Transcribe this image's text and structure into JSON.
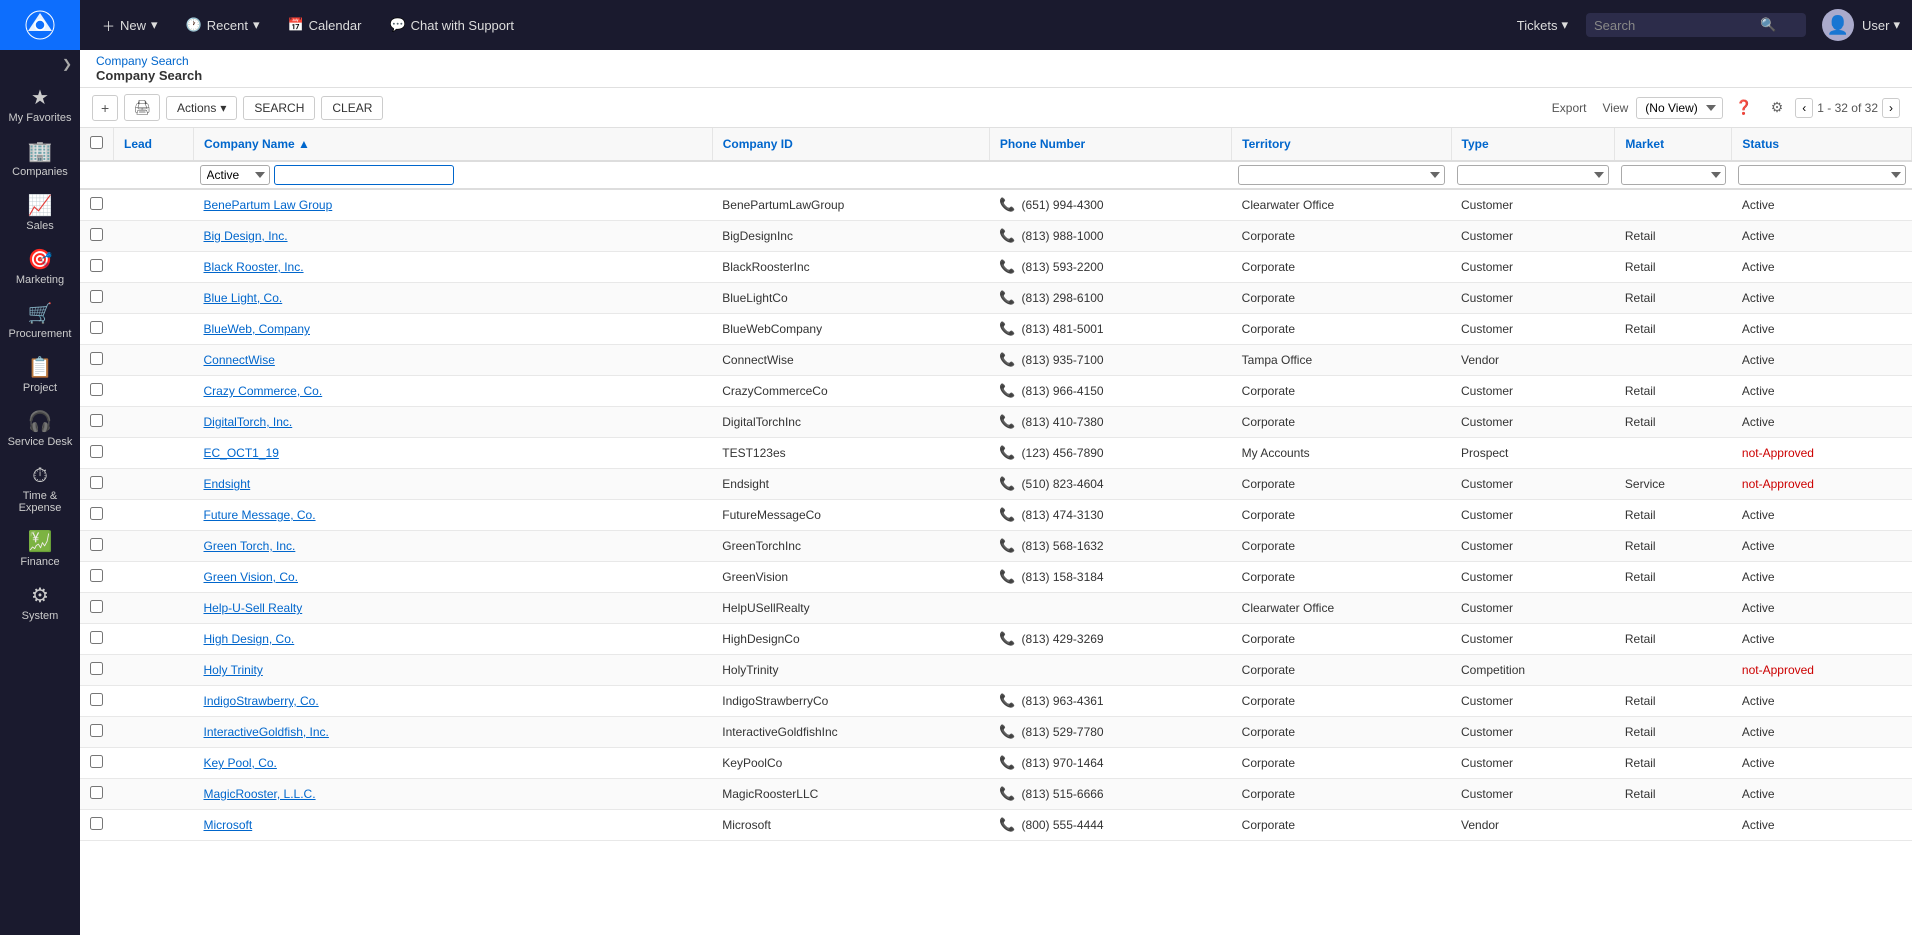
{
  "app": {
    "logo_alt": "ConnectWise",
    "topnav": {
      "new_label": "New",
      "recent_label": "Recent",
      "calendar_label": "Calendar",
      "chat_label": "Chat with Support",
      "tickets_label": "Tickets",
      "search_placeholder": "Search",
      "user_name": "User"
    }
  },
  "sidebar": {
    "items": [
      {
        "id": "favorites",
        "label": "My Favorites",
        "icon": "★"
      },
      {
        "id": "companies",
        "label": "Companies",
        "icon": "🏢"
      },
      {
        "id": "sales",
        "label": "Sales",
        "icon": "📈"
      },
      {
        "id": "marketing",
        "label": "Marketing",
        "icon": "🎯"
      },
      {
        "id": "procurement",
        "label": "Procurement",
        "icon": "🛒"
      },
      {
        "id": "project",
        "label": "Project",
        "icon": "📋"
      },
      {
        "id": "service-desk",
        "label": "Service Desk",
        "icon": "🎧"
      },
      {
        "id": "time-expense",
        "label": "Time & Expense",
        "icon": "⏱"
      },
      {
        "id": "finance",
        "label": "Finance",
        "icon": "💹"
      },
      {
        "id": "system",
        "label": "System",
        "icon": "⚙"
      }
    ]
  },
  "breadcrumb": {
    "parent": "Company Search",
    "current": "Company Search"
  },
  "toolbar": {
    "add_icon": "+",
    "print_icon": "🖨",
    "actions_label": "Actions",
    "search_label": "SEARCH",
    "clear_label": "CLEAR",
    "export_label": "Export",
    "view_label": "View",
    "view_placeholder": "(No View)",
    "pagination": "1 - 32 of 32"
  },
  "table": {
    "columns": [
      {
        "id": "checkbox",
        "label": ""
      },
      {
        "id": "lead",
        "label": "Lead"
      },
      {
        "id": "company_name",
        "label": "Company Name",
        "sorted": "asc"
      },
      {
        "id": "company_id",
        "label": "Company ID"
      },
      {
        "id": "phone_number",
        "label": "Phone Number"
      },
      {
        "id": "territory",
        "label": "Territory"
      },
      {
        "id": "type",
        "label": "Type"
      },
      {
        "id": "market",
        "label": "Market"
      },
      {
        "id": "status",
        "label": "Status"
      }
    ],
    "filter": {
      "active_value": "Active"
    },
    "rows": [
      {
        "lead": "",
        "company_name": "BenePartum Law Group",
        "company_id": "BenePartumLawGroup",
        "phone": "(651) 994-4300",
        "territory": "Clearwater Office",
        "type": "Customer",
        "market": "",
        "status": "Active",
        "has_phone": true
      },
      {
        "lead": "",
        "company_name": "Big Design, Inc.",
        "company_id": "BigDesignInc",
        "phone": "(813) 988-1000",
        "territory": "Corporate",
        "type": "Customer",
        "market": "Retail",
        "status": "Active",
        "has_phone": true
      },
      {
        "lead": "",
        "company_name": "Black Rooster, Inc.",
        "company_id": "BlackRoosterInc",
        "phone": "(813) 593-2200",
        "territory": "Corporate",
        "type": "Customer",
        "market": "Retail",
        "status": "Active",
        "has_phone": true
      },
      {
        "lead": "",
        "company_name": "Blue Light, Co.",
        "company_id": "BlueLightCo",
        "phone": "(813) 298-6100",
        "territory": "Corporate",
        "type": "Customer",
        "market": "Retail",
        "status": "Active",
        "has_phone": true
      },
      {
        "lead": "",
        "company_name": "BlueWeb, Company",
        "company_id": "BlueWebCompany",
        "phone": "(813) 481-5001",
        "territory": "Corporate",
        "type": "Customer",
        "market": "Retail",
        "status": "Active",
        "has_phone": true
      },
      {
        "lead": "",
        "company_name": "ConnectWise",
        "company_id": "ConnectWise",
        "phone": "(813) 935-7100",
        "territory": "Tampa Office",
        "type": "Vendor",
        "market": "",
        "status": "Active",
        "has_phone": true
      },
      {
        "lead": "",
        "company_name": "Crazy Commerce, Co.",
        "company_id": "CrazyCommerceCo",
        "phone": "(813) 966-4150",
        "territory": "Corporate",
        "type": "Customer",
        "market": "Retail",
        "status": "Active",
        "has_phone": true
      },
      {
        "lead": "",
        "company_name": "DigitalTorch, Inc.",
        "company_id": "DigitalTorchInc",
        "phone": "(813) 410-7380",
        "territory": "Corporate",
        "type": "Customer",
        "market": "Retail",
        "status": "Active",
        "has_phone": true
      },
      {
        "lead": "",
        "company_name": "EC_OCT1_19",
        "company_id": "TEST123es",
        "phone": "(123) 456-7890",
        "territory": "My Accounts",
        "type": "Prospect",
        "market": "",
        "status": "not-Approved",
        "has_phone": true
      },
      {
        "lead": "",
        "company_name": "Endsight",
        "company_id": "Endsight",
        "phone": "(510) 823-4604",
        "territory": "Corporate",
        "type": "Customer",
        "market": "Service",
        "status": "not-Approved",
        "has_phone": true
      },
      {
        "lead": "",
        "company_name": "Future Message, Co.",
        "company_id": "FutureMessageCo",
        "phone": "(813) 474-3130",
        "territory": "Corporate",
        "type": "Customer",
        "market": "Retail",
        "status": "Active",
        "has_phone": true
      },
      {
        "lead": "",
        "company_name": "Green Torch, Inc.",
        "company_id": "GreenTorchInc",
        "phone": "(813) 568-1632",
        "territory": "Corporate",
        "type": "Customer",
        "market": "Retail",
        "status": "Active",
        "has_phone": true
      },
      {
        "lead": "",
        "company_name": "Green Vision, Co.",
        "company_id": "GreenVision",
        "phone": "(813) 158-3184",
        "territory": "Corporate",
        "type": "Customer",
        "market": "Retail",
        "status": "Active",
        "has_phone": true
      },
      {
        "lead": "",
        "company_name": "Help-U-Sell Realty",
        "company_id": "HelpUSellRealty",
        "phone": "",
        "territory": "Clearwater Office",
        "type": "Customer",
        "market": "",
        "status": "Active",
        "has_phone": false
      },
      {
        "lead": "",
        "company_name": "High Design, Co.",
        "company_id": "HighDesignCo",
        "phone": "(813) 429-3269",
        "territory": "Corporate",
        "type": "Customer",
        "market": "Retail",
        "status": "Active",
        "has_phone": true
      },
      {
        "lead": "",
        "company_name": "Holy Trinity",
        "company_id": "HolyTrinity",
        "phone": "",
        "territory": "Corporate",
        "type": "Competition",
        "market": "",
        "status": "not-Approved",
        "has_phone": false
      },
      {
        "lead": "",
        "company_name": "IndigoStrawberry, Co.",
        "company_id": "IndigoStrawberryCo",
        "phone": "(813) 963-4361",
        "territory": "Corporate",
        "type": "Customer",
        "market": "Retail",
        "status": "Active",
        "has_phone": true
      },
      {
        "lead": "",
        "company_name": "InteractiveGoldfish, Inc.",
        "company_id": "InteractiveGoldfishInc",
        "phone": "(813) 529-7780",
        "territory": "Corporate",
        "type": "Customer",
        "market": "Retail",
        "status": "Active",
        "has_phone": true
      },
      {
        "lead": "",
        "company_name": "Key Pool, Co.",
        "company_id": "KeyPoolCo",
        "phone": "(813) 970-1464",
        "territory": "Corporate",
        "type": "Customer",
        "market": "Retail",
        "status": "Active",
        "has_phone": true
      },
      {
        "lead": "",
        "company_name": "MagicRooster, L.L.C.",
        "company_id": "MagicRoosterLLC",
        "phone": "(813) 515-6666",
        "territory": "Corporate",
        "type": "Customer",
        "market": "Retail",
        "status": "Active",
        "has_phone": true
      },
      {
        "lead": "",
        "company_name": "Microsoft",
        "company_id": "Microsoft",
        "phone": "(800) 555-4444",
        "territory": "Corporate",
        "type": "Vendor",
        "market": "",
        "status": "Active",
        "has_phone": true
      }
    ]
  }
}
